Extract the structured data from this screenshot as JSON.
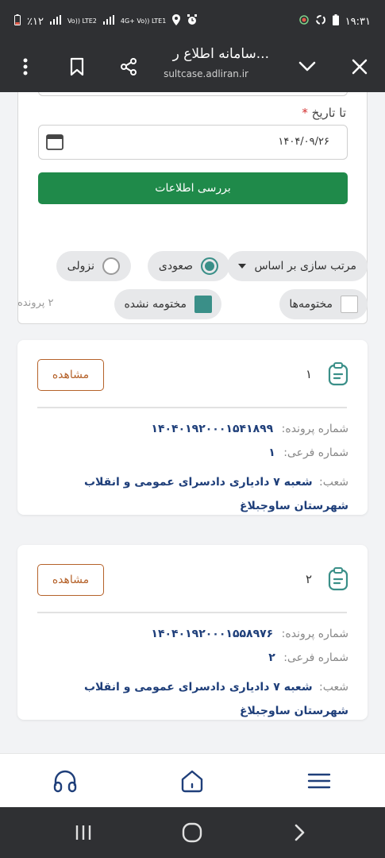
{
  "status_bar": {
    "battery_text": "٪۱۲",
    "network_1": "Vo)) LTE2",
    "network_2": "4G+ Vo)) LTE1",
    "time": "۱۹:۳۱"
  },
  "browser": {
    "title": "سامانه اطلاع ر...",
    "url": "sultcase.adliran.ir"
  },
  "form": {
    "to_date_label": "تا تاریخ",
    "required_mark": "*",
    "to_date_value": "۱۴۰۴/۰۹/۲۶",
    "submit_label": "بررسی اطلاعات"
  },
  "sort": {
    "label": "مرتب سازی بر اساس",
    "ascending": "صعودی",
    "descending": "نزولی",
    "selected": "ascending"
  },
  "filters": {
    "closed_label": "مختومه‌ها",
    "closed_checked": false,
    "open_label": "مختومه نشده",
    "open_checked": true,
    "count_text": "۲ پرونده"
  },
  "results": [
    {
      "index": "۱",
      "view_label": "مشاهده",
      "case_number_label": "شماره پرونده:",
      "case_number": "۱۴۰۴۰۱۹۲۰۰۰۱۵۴۱۸۹۹",
      "sub_number_label": "شماره فرعی:",
      "sub_number": "۱",
      "branch_label": "شعب:",
      "branch": "شعبه ۷ داديارى دادسراى عمومى و انقلاب شهرستان ساوجبلاغ"
    },
    {
      "index": "۲",
      "view_label": "مشاهده",
      "case_number_label": "شماره پرونده:",
      "case_number": "۱۴۰۴۰۱۹۲۰۰۰۱۵۵۸۹۷۶",
      "sub_number_label": "شماره فرعی:",
      "sub_number": "۲",
      "branch_label": "شعب:",
      "branch": "شعبه ۷ داديارى دادسراى عمومى و انقلاب شهرستان ساوجبلاغ"
    }
  ],
  "colors": {
    "primary_green": "#1f8a4a",
    "teal": "#3a8f88",
    "view_orange": "#b5622a",
    "value_blue": "#1f3f7a"
  },
  "icons": {
    "bottom_nav": [
      "support-icon",
      "home-icon",
      "menu-icon"
    ],
    "system_nav": [
      "recents-icon",
      "home-circle-icon",
      "back-icon"
    ]
  }
}
